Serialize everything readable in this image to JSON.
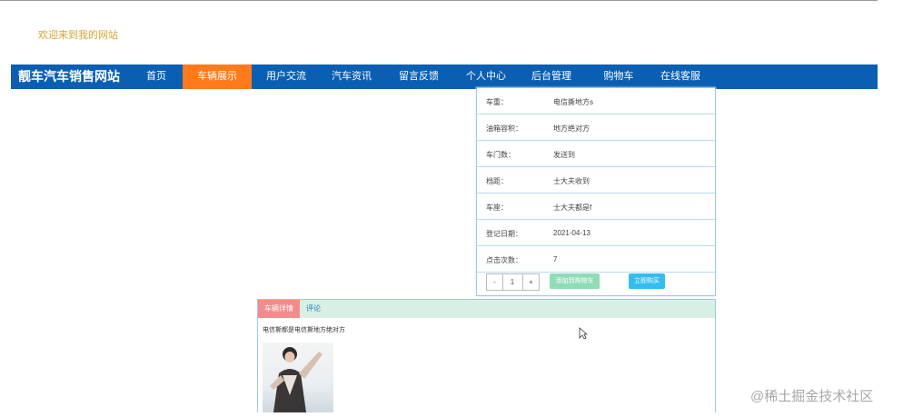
{
  "welcome": "欢迎来到我的网站",
  "brand": "靓车汽车销售网站",
  "nav": [
    {
      "label": "首页"
    },
    {
      "label": "车辆展示"
    },
    {
      "label": "用户交流"
    },
    {
      "label": "汽车资讯"
    },
    {
      "label": "留言反馈"
    },
    {
      "label": "个人中心"
    },
    {
      "label": "后台管理"
    },
    {
      "label": "购物车"
    },
    {
      "label": "在线客服"
    }
  ],
  "nav_active": "车辆展示",
  "details": [
    {
      "label": "车重：",
      "value": "电信撕地方s"
    },
    {
      "label": "油箱容积：",
      "value": "地方绝对方"
    },
    {
      "label": "车门数：",
      "value": "发送到"
    },
    {
      "label": "档距：",
      "value": "士大夫收到"
    },
    {
      "label": "车座：",
      "value": "士大夫都是f"
    },
    {
      "label": "登记日期：",
      "value": "2021-04-13"
    },
    {
      "label": "点击次数：",
      "value": "7"
    }
  ],
  "quantity": {
    "minus": "-",
    "value": "1",
    "plus": "+"
  },
  "buttons": {
    "add_cart": "添加到购物车",
    "buy_now": "立即购买"
  },
  "tabs": {
    "detail": "车辆详情",
    "comment": "评论"
  },
  "description": "电信撕都是电信撕地方绝对方",
  "watermark": "@稀土掘金技术社区",
  "colors": {
    "nav_bg": "#0b5fb3",
    "nav_active": "#ff7a1a",
    "welcome": "#d9a233"
  }
}
